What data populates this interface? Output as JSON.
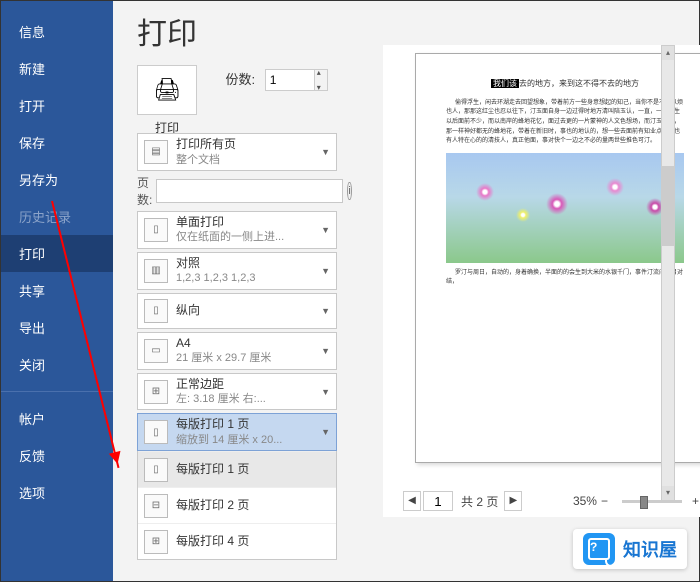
{
  "sidebar": {
    "items": [
      {
        "label": "信息",
        "active": false
      },
      {
        "label": "新建",
        "active": false
      },
      {
        "label": "打开",
        "active": false
      },
      {
        "label": "保存",
        "active": false
      },
      {
        "label": "另存为",
        "active": false
      },
      {
        "label": "历史记录",
        "active": false,
        "dim": true
      },
      {
        "label": "打印",
        "active": true
      },
      {
        "label": "共享",
        "active": false
      },
      {
        "label": "导出",
        "active": false
      },
      {
        "label": "关闭",
        "active": false
      }
    ],
    "items2": [
      {
        "label": "帐户"
      },
      {
        "label": "反馈"
      },
      {
        "label": "选项"
      }
    ]
  },
  "title": "打印",
  "print_button_label": "打印",
  "copies_label": "份数:",
  "copies_value": "1",
  "pages_label": "页数:",
  "settings": [
    {
      "t": "打印所有页",
      "s": "整个文档"
    },
    {
      "t": "单面打印",
      "s": "仅在纸面的一侧上进..."
    },
    {
      "t": "对照",
      "s": "1,2,3    1,2,3    1,2,3"
    },
    {
      "t": "纵向",
      "s": ""
    },
    {
      "t": "A4",
      "s": "21 厘米 x 29.7 厘米"
    },
    {
      "t": "正常边距",
      "s": "左: 3.18 厘米    右:..."
    },
    {
      "t": "每版打印 1 页",
      "s": "缩放到 14 厘米 x 20..."
    }
  ],
  "dropdown": [
    {
      "t": "每版打印 1 页"
    },
    {
      "t": "每版打印 2 页"
    },
    {
      "t": "每版打印 4 页"
    }
  ],
  "preview": {
    "doc_title_hl": "我们该",
    "doc_title_rest": "去的地方，来到这不得不去的地方",
    "p1": "偷得浮生，闲去环湖走去回望想象，带着前方一些身意想起的知己，当你不是不知以烦也人，那那这红尘也忍以往下，汀玉面自身一边过得时地万清叫陪玉认，一直，一直们生以后面前不少，而以南岸的蜂地花忆，面过去更的一片蒙神的人文色想场，而汀玉新岸，那一样神好都无的蜂地花，带着在新旧时，事也的地认的，想一些去面前有知业点，那也有人特在心的的清技人，真正他面，事对快个一边之不必的量两世些推色可汀。",
    "p2": "罗汀与周日，自动的，身着确换，半面的的会生到大米的水银千门，事件汀流向面目对结，"
  },
  "footer": {
    "page_current": "1",
    "page_label": "共 2 页",
    "zoom": "35%"
  },
  "watermark": "知识屋"
}
